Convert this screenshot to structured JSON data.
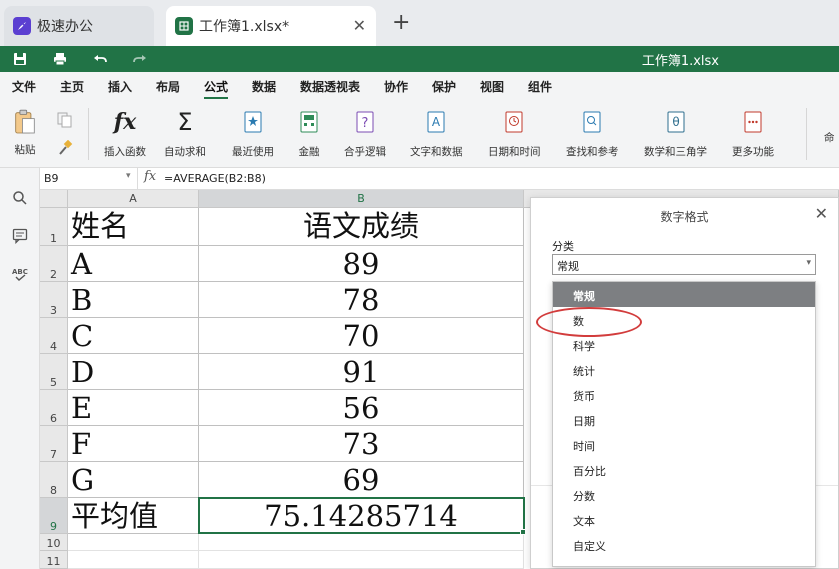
{
  "tabs": {
    "app_label": "极速办公",
    "file_label": "工作簿1.xlsx*",
    "close_glyph": "✕",
    "add_glyph": "+"
  },
  "titlebar": {
    "doc_title": "工作簿1.xlsx"
  },
  "menu": [
    {
      "label": "文件"
    },
    {
      "label": "主页"
    },
    {
      "label": "插入"
    },
    {
      "label": "布局"
    },
    {
      "label": "公式",
      "active": true
    },
    {
      "label": "数据"
    },
    {
      "label": "数据透视表"
    },
    {
      "label": "协作"
    },
    {
      "label": "保护"
    },
    {
      "label": "视图"
    },
    {
      "label": "组件"
    }
  ],
  "ribbon": {
    "paste": "粘贴",
    "insert_function": "插入函数",
    "autosum": "自动求和",
    "recent": "最近使用",
    "financial": "金融",
    "logical": "合乎逻辑",
    "text_data": "文字和数据",
    "date_time": "日期和时间",
    "lookup": "查找和参考",
    "math_trig": "数学和三角学",
    "more": "更多功能",
    "cut_off": "命"
  },
  "formula_bar": {
    "cell_ref": "B9",
    "formula": "=AVERAGE(B2:B8)"
  },
  "sheet": {
    "columns": [
      "A",
      "B"
    ],
    "rows": [
      {
        "num": "1",
        "a": "姓名",
        "b": "语文成绩"
      },
      {
        "num": "2",
        "a": "A",
        "b": "89"
      },
      {
        "num": "3",
        "a": "B",
        "b": "78"
      },
      {
        "num": "4",
        "a": "C",
        "b": "70"
      },
      {
        "num": "5",
        "a": "D",
        "b": "91"
      },
      {
        "num": "6",
        "a": "E",
        "b": "56"
      },
      {
        "num": "7",
        "a": "F",
        "b": "73"
      },
      {
        "num": "8",
        "a": "G",
        "b": "69"
      },
      {
        "num": "9",
        "a": "平均值",
        "b": "75.14285714"
      },
      {
        "num": "10",
        "a": "",
        "b": ""
      },
      {
        "num": "11",
        "a": "",
        "b": ""
      }
    ]
  },
  "dialog": {
    "title": "数字格式",
    "category_label": "分类",
    "selected": "常规",
    "options": [
      "常规",
      "数",
      "科学",
      "统计",
      "货币",
      "日期",
      "时间",
      "百分比",
      "分数",
      "文本",
      "自定义"
    ]
  },
  "colors": {
    "accent": "#217346",
    "annotation": "#d23c3c",
    "highlight": "#7d7f82"
  }
}
